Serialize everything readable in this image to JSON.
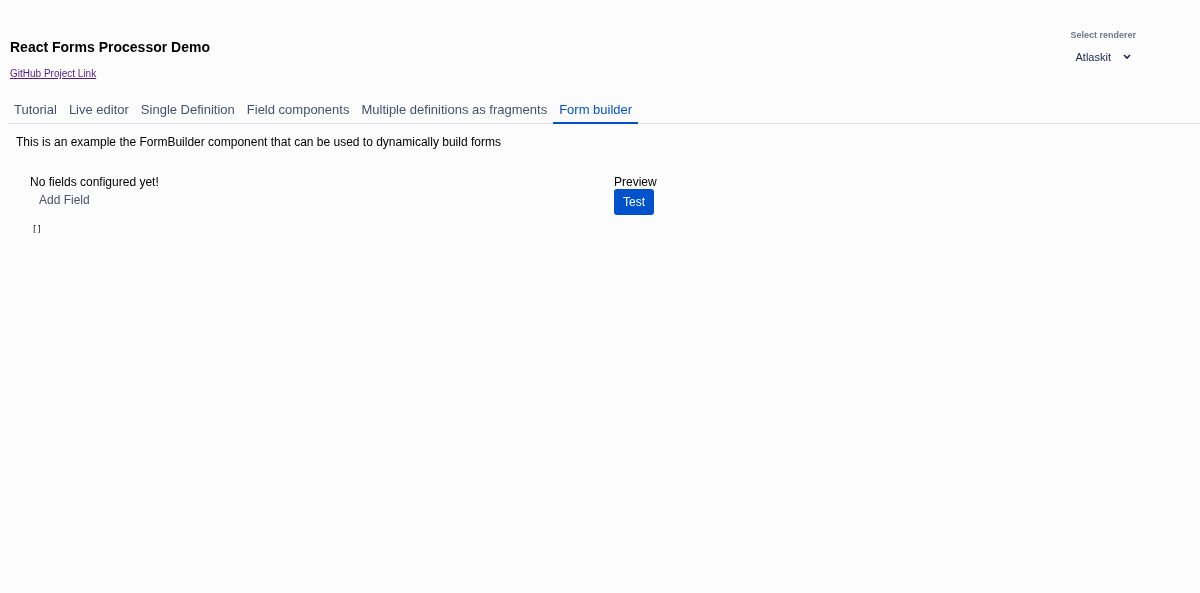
{
  "header": {
    "title": "React Forms Processor Demo",
    "link": "GitHub Project Link"
  },
  "renderer": {
    "label": "Select renderer",
    "value": "Atlaskit"
  },
  "tabs": [
    {
      "label": "Tutorial",
      "selected": false
    },
    {
      "label": "Live editor",
      "selected": false
    },
    {
      "label": "Single Definition",
      "selected": false
    },
    {
      "label": "Field components",
      "selected": false
    },
    {
      "label": "Multiple definitions as fragments",
      "selected": false
    },
    {
      "label": "Form builder",
      "selected": true
    }
  ],
  "description": "This is an example the FormBuilder component that can be used to dynamically build forms",
  "builder": {
    "empty_message": "No fields configured yet!",
    "add_button": "Add Field",
    "json_output": "[]"
  },
  "preview": {
    "heading": "Preview",
    "button": "Test"
  }
}
